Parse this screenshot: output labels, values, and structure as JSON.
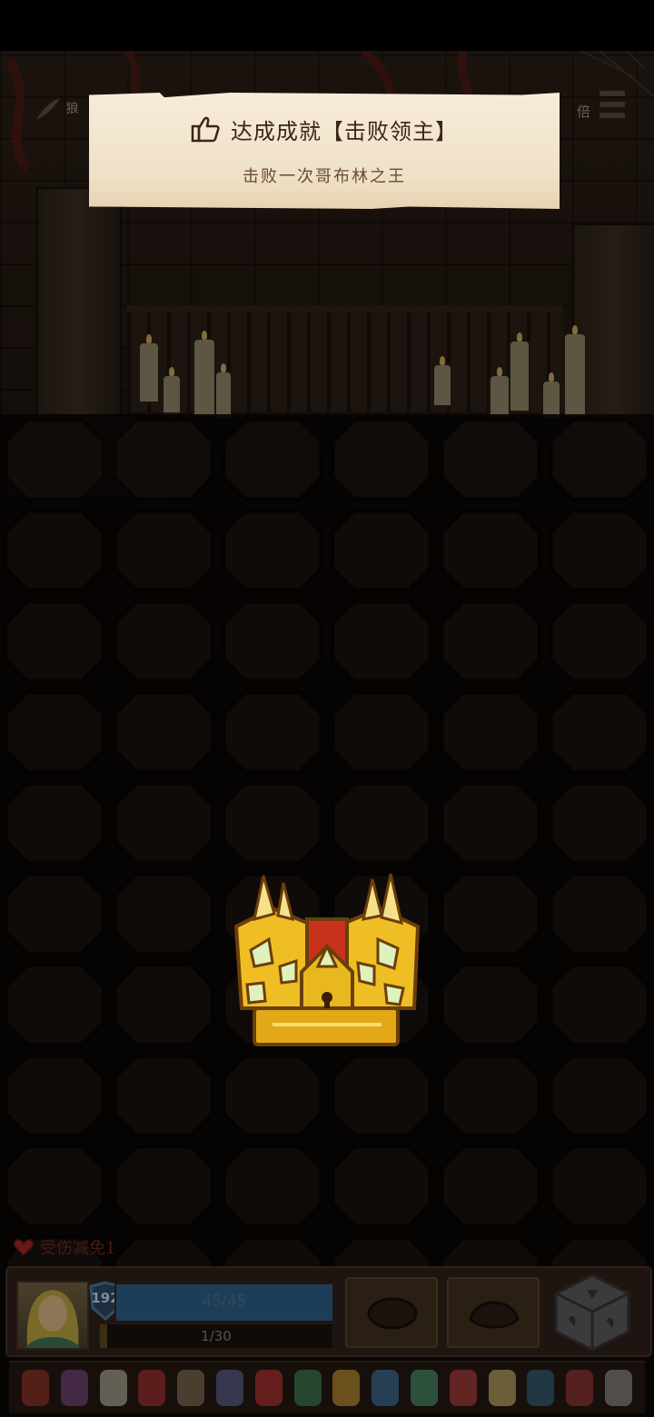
{
  "achievement": {
    "title": "达成成就【击败领主】",
    "description": "击败一次哥布林之王"
  },
  "hud": {
    "top_left_text": "狼",
    "top_right_text": "倍",
    "damage_reduction": "受伤减免1",
    "level": "192",
    "hp": "45/45",
    "hp_fraction": 1.0,
    "xp": "1/30",
    "xp_fraction": 0.033
  },
  "icons": {
    "banner": "thumbs-up-icon",
    "chest": "golden-treasure-chest-icon",
    "dice": "dice-icon",
    "menu": "menu-icon",
    "heart": "heart-icon"
  },
  "colors": {
    "banner_bg": "#f2e6d0",
    "title_text": "#3b2418",
    "chest_gold": "#e9b81e",
    "hp_bar": "#1e3e58"
  }
}
